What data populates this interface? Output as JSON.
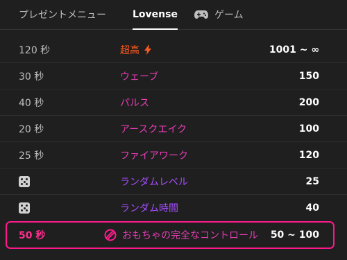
{
  "tabs": [
    {
      "label": "プレゼントメニュー"
    },
    {
      "label": "Lovense"
    },
    {
      "label": "ゲーム",
      "icon": "gamepad-icon"
    }
  ],
  "rows": [
    {
      "time": "120 秒",
      "name": "超高",
      "value": "1001 ~ ∞",
      "name_color": "#ff5a1f",
      "badge_icon": "lightning-icon"
    },
    {
      "time": "30 秒",
      "name": "ウェーブ",
      "value": "150",
      "name_color": "#e63db5"
    },
    {
      "time": "40 秒",
      "name": "パルス",
      "value": "200",
      "name_color": "#e63db5"
    },
    {
      "time": "20 秒",
      "name": "アースクエイク",
      "value": "100",
      "name_color": "#e63db5"
    },
    {
      "time": "25 秒",
      "name": "ファイアワーク",
      "value": "120",
      "name_color": "#e63db5"
    },
    {
      "time_icon": "dice-icon",
      "name": "ランダムレベル",
      "value": "25",
      "name_color": "#a64dff"
    },
    {
      "time_icon": "dice-icon",
      "name": "ランダム時間",
      "value": "40",
      "name_color": "#a64dff"
    }
  ],
  "highlight": {
    "time": "50 秒",
    "name": "おもちゃの完全なコントロール",
    "value": "50 ~ 100",
    "name_color": "#e63db5",
    "accent": "#ff1a8c",
    "icon": "toy-control-icon"
  }
}
